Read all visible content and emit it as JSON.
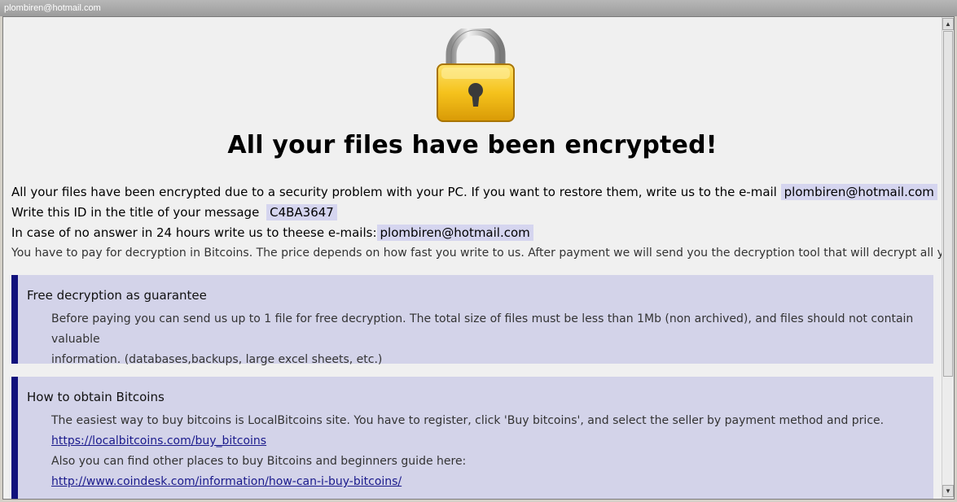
{
  "window": {
    "title": "plombiren@hotmail.com"
  },
  "headline": "All your files have been encrypted!",
  "intro": {
    "line1_text": "All your files have been encrypted due to a security problem with your PC. If you want to restore them, write us to the e-mail",
    "line1_email": "plombiren@hotmail.com",
    "line2_text": "Write this ID in the title of your message",
    "line2_id": "C4BA3647",
    "line3_text": "In case of no answer in 24 hours write us to theese e-mails:",
    "line3_email": "plombiren@hotmail.com",
    "line4_text": "You have to pay for decryption in Bitcoins. The price depends on how fast you write to us. After payment we will send you the decryption tool that will decrypt all your files."
  },
  "panels": [
    {
      "title": "Free decryption as guarantee",
      "body_line1": "Before paying you can send us up to 1 file for free decryption. The total size of files must be less than 1Mb (non archived), and files should not contain valuable",
      "body_line2": "information. (databases,backups, large excel sheets, etc.)"
    },
    {
      "title": "How to obtain Bitcoins",
      "body_line1": "The easiest way to buy bitcoins is LocalBitcoins site. You have to register, click 'Buy bitcoins', and select the seller by payment method and price.",
      "link1": "https://localbitcoins.com/buy_bitcoins",
      "body_line2": "Also you can find other places to buy Bitcoins and beginners guide here:",
      "link2": "http://www.coindesk.com/information/how-can-i-buy-bitcoins/"
    }
  ],
  "scrollbar": {
    "up_icon": "triangle-up",
    "down_icon": "triangle-down"
  },
  "colors": {
    "panel_bg": "#d3d3e9",
    "panel_accent": "#10107c",
    "pill_bg": "#d5d5ef",
    "lock_gold": "#f2c218"
  }
}
